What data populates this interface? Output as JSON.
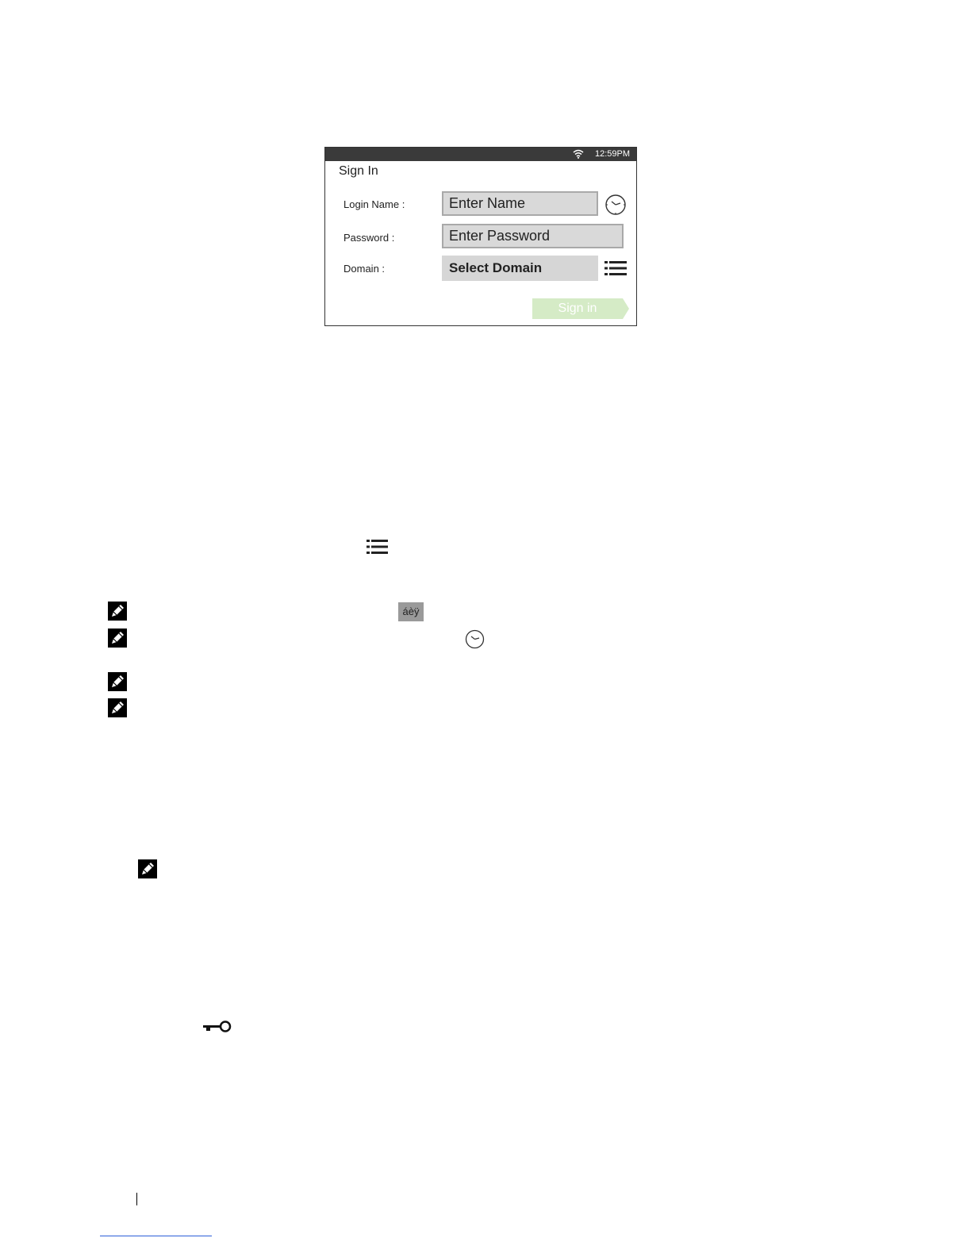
{
  "device": {
    "status_time": "12:59PM",
    "title": "Sign In",
    "fields": {
      "login_label": "Login Name :",
      "login_placeholder": "Enter Name",
      "password_label": "Password :",
      "password_placeholder": "Enter Password",
      "domain_label": "Domain :",
      "domain_value": "Select Domain"
    },
    "signin_label": "Sign in",
    "colors": {
      "status_bar": "#3a3a3a",
      "field_bg": "#d9d9d9",
      "signin_bg": "#d5ebc6"
    }
  },
  "document": {
    "accent_button_label": "áèÿ",
    "icons": [
      "list-icon",
      "note-icon",
      "history-clock-icon",
      "key-icon"
    ]
  }
}
